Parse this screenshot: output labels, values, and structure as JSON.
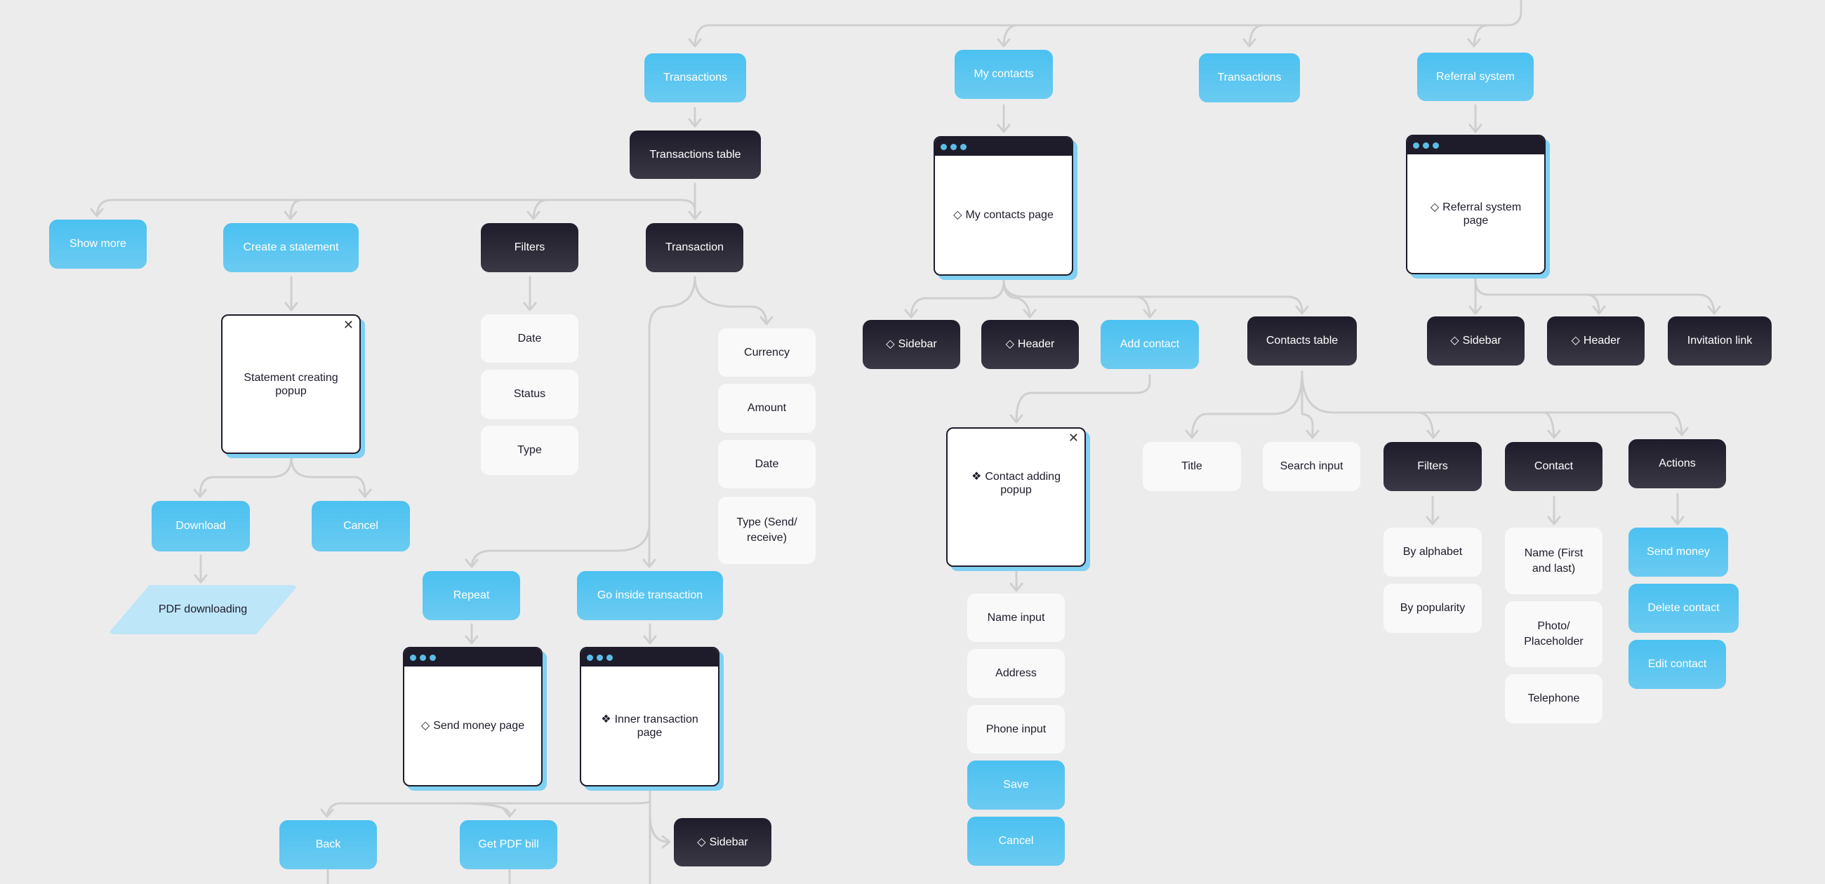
{
  "colors": {
    "primary": "#4bc1f1",
    "dark": "#1e1c2a",
    "light": "#f9f9f9",
    "background": "#ececec",
    "connector": "#cfcfcf",
    "shadow": "#7fd0f2"
  },
  "icons": {
    "component": "◇",
    "instance": "❖",
    "close": "✕"
  },
  "nodes": {
    "transactions_top": "Transactions",
    "my_contacts": "My contacts",
    "transactions_2": "Transactions",
    "referral_system": "Referral system",
    "transactions_table": "Transactions table",
    "show_more": "Show more",
    "create_statement": "Create a statement",
    "tx_filters": "Filters",
    "transaction": "Transaction",
    "statement_popup": "Statement creating popup",
    "download": "Download",
    "statement_cancel": "Cancel",
    "pdf_downloading": "PDF downloading",
    "filter_date": "Date",
    "filter_status": "Status",
    "filter_type": "Type",
    "tx_currency": "Currency",
    "tx_amount": "Amount",
    "tx_date": "Date",
    "tx_type": "Type (Send/ receive)",
    "repeat": "Repeat",
    "go_inside": "Go inside transaction",
    "send_money_page": "Send money page",
    "inner_tx_page": "Inner transaction page",
    "back": "Back",
    "get_pdf_bill": "Get PDF bill",
    "inner_sidebar": "Sidebar",
    "my_contacts_page": "My contacts page",
    "contacts_sidebar": "Sidebar",
    "contacts_header": "Header",
    "add_contact": "Add contact",
    "contacts_table": "Contacts table",
    "contact_popup": "Contact adding popup",
    "name_input": "Name input",
    "address": "Address",
    "phone_input": "Phone input",
    "save": "Save",
    "popup_cancel": "Cancel",
    "ct_title": "Title",
    "ct_search": "Search input",
    "ct_filters": "Filters",
    "ct_contact": "Contact",
    "ct_actions": "Actions",
    "by_alphabet": "By alphabet",
    "by_popularity": "By popularity",
    "contact_name": "Name (First and last)",
    "contact_photo": "Photo/ Placeholder",
    "contact_telephone": "Telephone",
    "send_money": "Send money",
    "delete_contact": "Delete contact",
    "edit_contact": "Edit contact",
    "referral_page": "Referral system page",
    "ref_sidebar": "Sidebar",
    "ref_header": "Header",
    "invitation_link": "Invitation link"
  }
}
